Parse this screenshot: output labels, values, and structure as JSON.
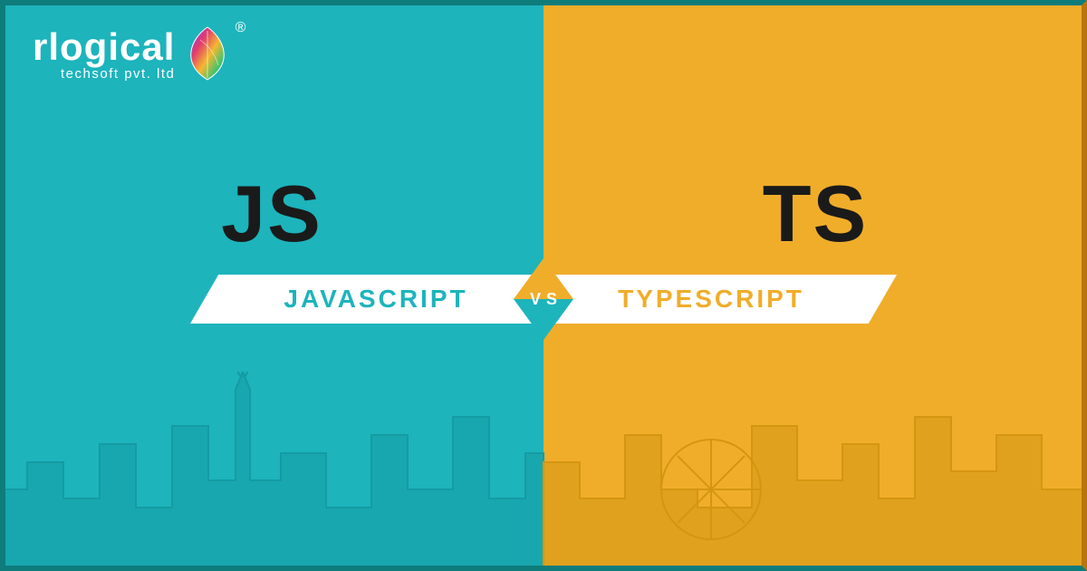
{
  "brand": {
    "name": "rlogical",
    "tagline": "techsoft pvt. ltd",
    "registered": "®"
  },
  "left": {
    "short": "JS",
    "full": "JAVASCRIPT",
    "color": "#1db4bc"
  },
  "right": {
    "short": "TS",
    "full": "TYPESCRIPT",
    "color": "#f0ad2a"
  },
  "vs": "VS"
}
